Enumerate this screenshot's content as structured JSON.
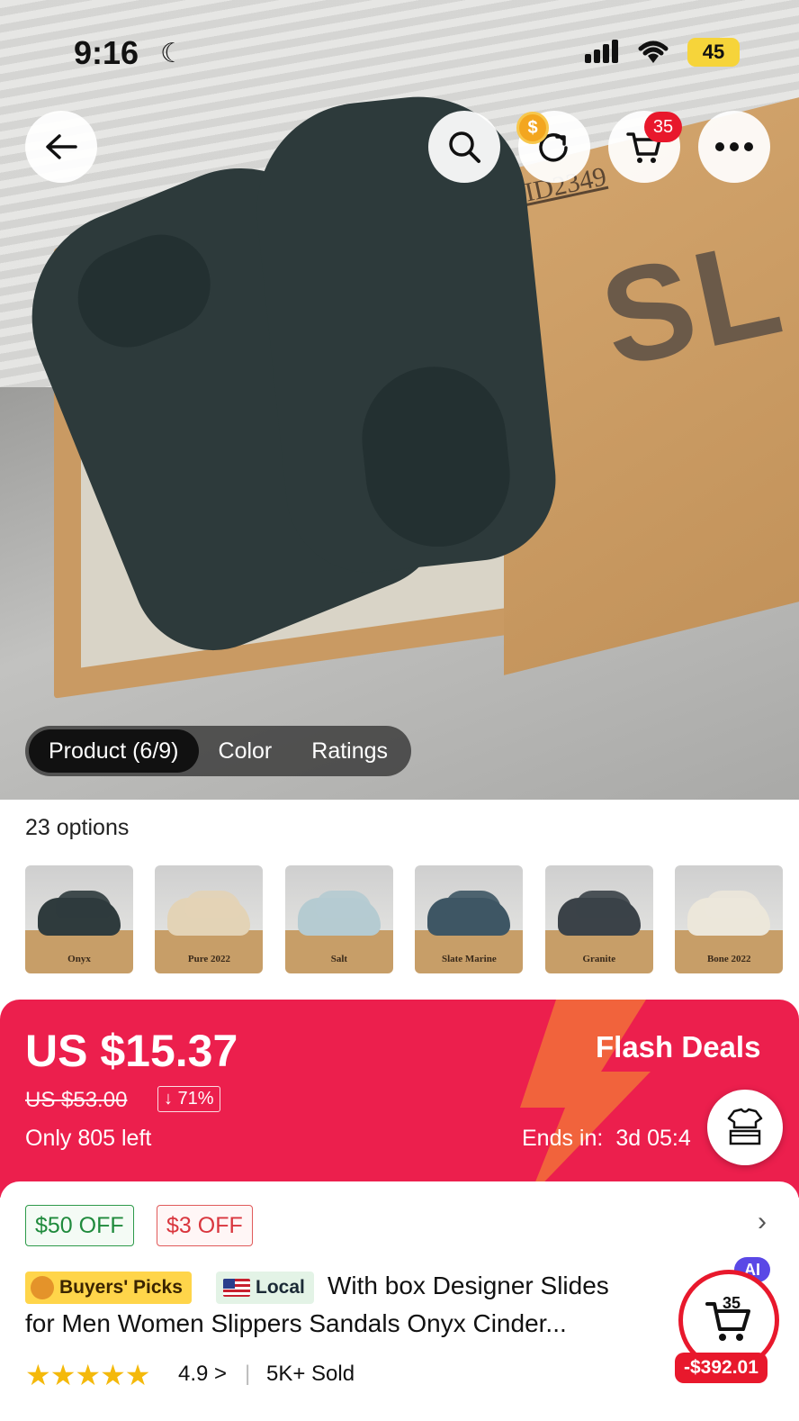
{
  "status_bar": {
    "time": "9:16",
    "battery": "45"
  },
  "hero": {
    "box_text": "SL",
    "box_id": "#ID2349",
    "tabs": [
      {
        "label": "Product (6/9)",
        "active": true
      },
      {
        "label": "Color",
        "active": false
      },
      {
        "label": "Ratings",
        "active": false
      }
    ]
  },
  "header": {
    "cart_count": "35"
  },
  "icons": {
    "back": "back-arrow-icon",
    "search": "search-icon",
    "share": "share-icon",
    "cart": "cart-icon",
    "more": "more-icon",
    "coin": "coin-icon"
  },
  "options": {
    "label": "23 options",
    "items": [
      {
        "name": "Onyx",
        "color": "#2f3b3d"
      },
      {
        "name": "Pure 2022",
        "color": "#e3d3b6"
      },
      {
        "name": "Salt",
        "color": "#b5cbd1"
      },
      {
        "name": "Slate Marine",
        "color": "#3e5664"
      },
      {
        "name": "Granite",
        "color": "#3b4248"
      },
      {
        "name": "Bone 2022",
        "color": "#ece7da"
      },
      {
        "name": "",
        "color": "#c9c9c9"
      }
    ]
  },
  "flash_deal": {
    "price": "US $15.37",
    "original_price": "US $53.00",
    "discount": "↓ 71%",
    "stock": "Only 805 left",
    "title": "Flash Deals",
    "ends_label": "Ends in:",
    "ends_value": "3d 05:4",
    "accent": "#ec1f4d"
  },
  "coupons": [
    "$50 OFF",
    "$3 OFF"
  ],
  "product": {
    "badge_picks": "Buyers' Picks",
    "badge_local": "Local",
    "title_line1": "With box Designer Slides",
    "title_line2": "for Men Women Slippers Sandals Onyx Cinder...",
    "stars": "★★★★★",
    "rating": "4.9 >",
    "sold": "5K+ Sold"
  },
  "floating_cart": {
    "ai_label": "AI",
    "count": "35",
    "total": "-$392.01"
  }
}
